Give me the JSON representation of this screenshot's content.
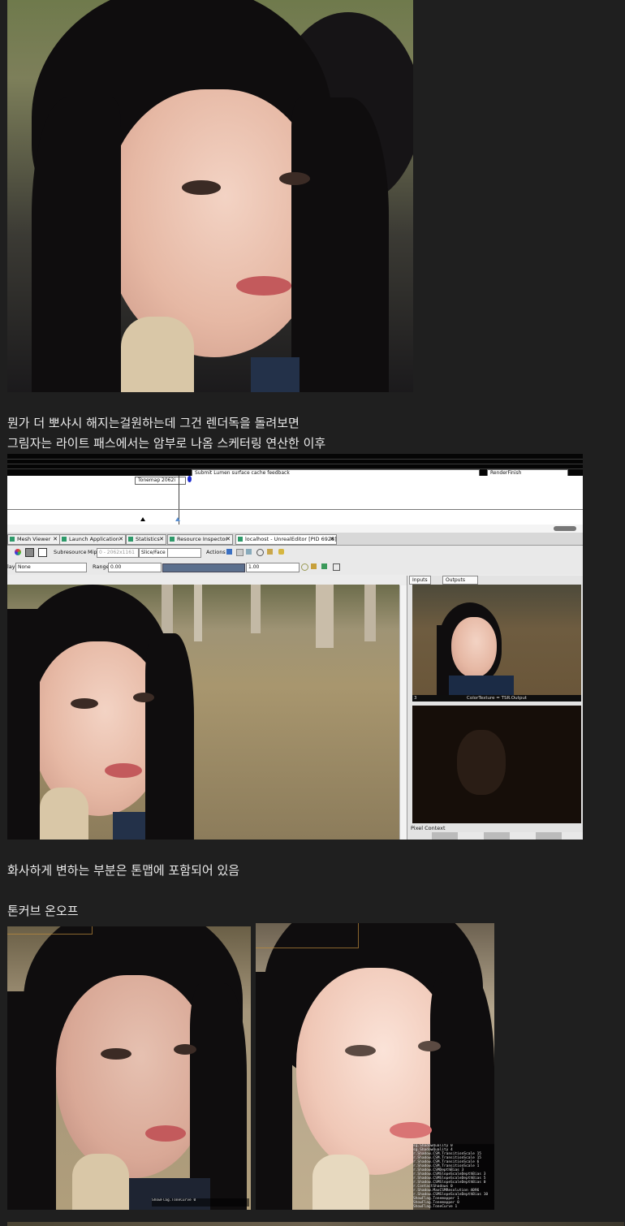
{
  "post": {
    "caption_line1": "뭔가 더 뽀샤시 해지는걸원하는데 그건 렌더독을 돌려보면",
    "caption_line2": "그림자는 라이트 패스에서는 암부로 나옴 스케터링 연산한 이후",
    "caption_tonemap": "화사하게 변하는 부분은 톤맵에 포함되어 있음",
    "caption_tonecurve": "톤커브 온오프"
  },
  "renderdoc": {
    "timeline": {
      "event_tonemap": "Tonemap 2062i",
      "event_lumen": "Submit Lumen surface cache feedback",
      "event_renderfinish": "RenderFinish"
    },
    "tabs": [
      {
        "label": "Mesh Viewer"
      },
      {
        "label": "Launch Application"
      },
      {
        "label": "Statistics"
      },
      {
        "label": "Resource Inspector"
      },
      {
        "label": "localhost - UnrealEditor [PID 6928]"
      }
    ],
    "toolbar1": {
      "subresource_label": "Subresource",
      "mip_label": "Mip",
      "mip_value": "0 - 2062x1161",
      "slice_label": "Slice/Face",
      "actions_label": "Actions"
    },
    "toolbar2": {
      "overlay_label": "lay",
      "overlay_value": "None",
      "range_label": "Range",
      "range_min": "0.00",
      "range_max": "1.00"
    },
    "side_panel": {
      "tab_inputs": "Inputs",
      "tab_outputs": "Outputs",
      "thumb1_id": "3",
      "thumb1_label": "ColorTexture = TSR.Output",
      "pixel_context_label": "Pixel Context"
    }
  },
  "console_left": "ShowFlag.ToneCurve 0",
  "console_right": "sg.ShadowQuality 0\nsg.ShadowQuality 4\nr.Shadow.CSM.TransitionScale 15\nr.Shadow.CSM.TransitionScale 15\nr.Shadow.CSM.TransitionScale 6\nr.Shadow.CSM.TransitionScale 1\nr.Shadow.CSMDepthBias 3\nr.Shadow.CSMSlopeScaleDepthBias 3\nr.Shadow.CSMSlopeScaleDepthBias 5\nr.Shadow.CSMSlopeScaleDepthBias 0\nr.ContactShadows 0\nr.Shadow.MaxCSMResolution 4096\nr.Shadow.CSMSlopeScaleDepthBias 10\nShowFlag.Tonemapper 1\nShowFlag.Tonemapper 0\nShowFlag.ToneCurve 1",
  "colors": {
    "page_bg": "#1f1f1f",
    "text": "#ececec",
    "tab_icon": "#2e9a6a",
    "range_bar": "#5b6f8d"
  }
}
